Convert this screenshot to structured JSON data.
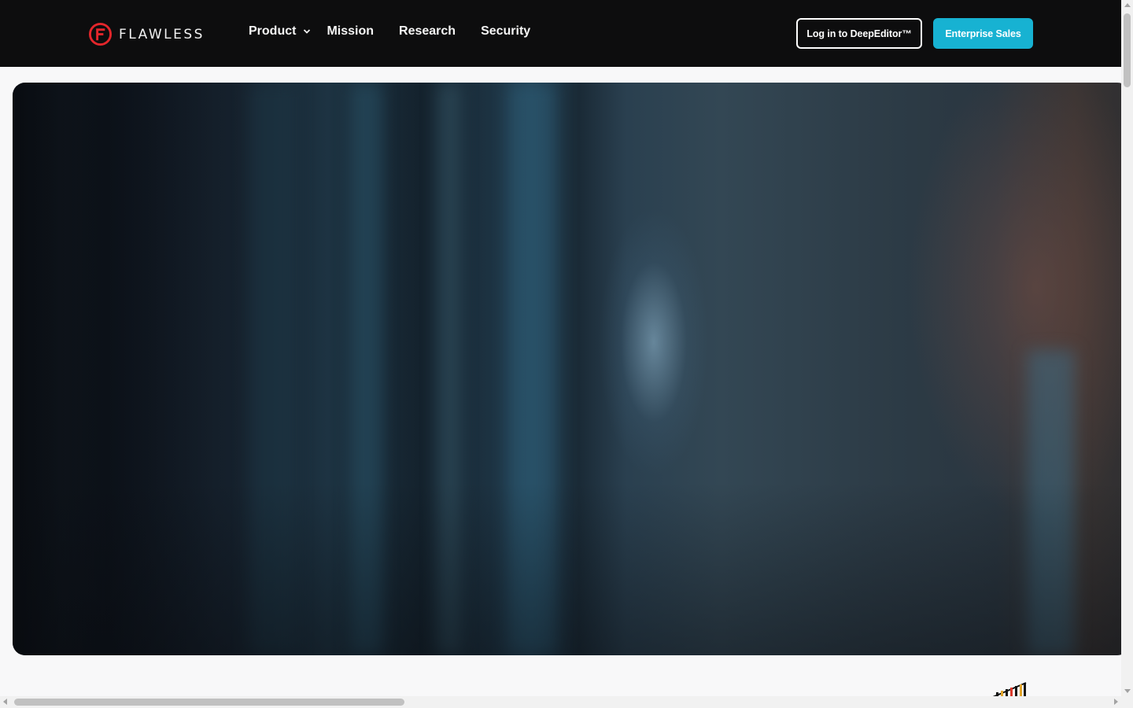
{
  "header": {
    "logo_text": "FLAWLESS",
    "nav": [
      {
        "label": "Product",
        "has_dropdown": true
      },
      {
        "label": "Mission"
      },
      {
        "label": "Research"
      },
      {
        "label": "Security"
      }
    ],
    "login_label": "Log in to DeepEditor™",
    "sales_label": "Enterprise Sales"
  },
  "colors": {
    "header_bg": "#0d0d0e",
    "accent": "#17b2d2",
    "logo_red": "#e3262b",
    "page_bg": "#f8f8f9"
  },
  "hero": {
    "type": "video-still",
    "icon": "hero-video-frame"
  },
  "scrollbars": {
    "vertical_position": 0.0,
    "horizontal_position": 0.0
  }
}
